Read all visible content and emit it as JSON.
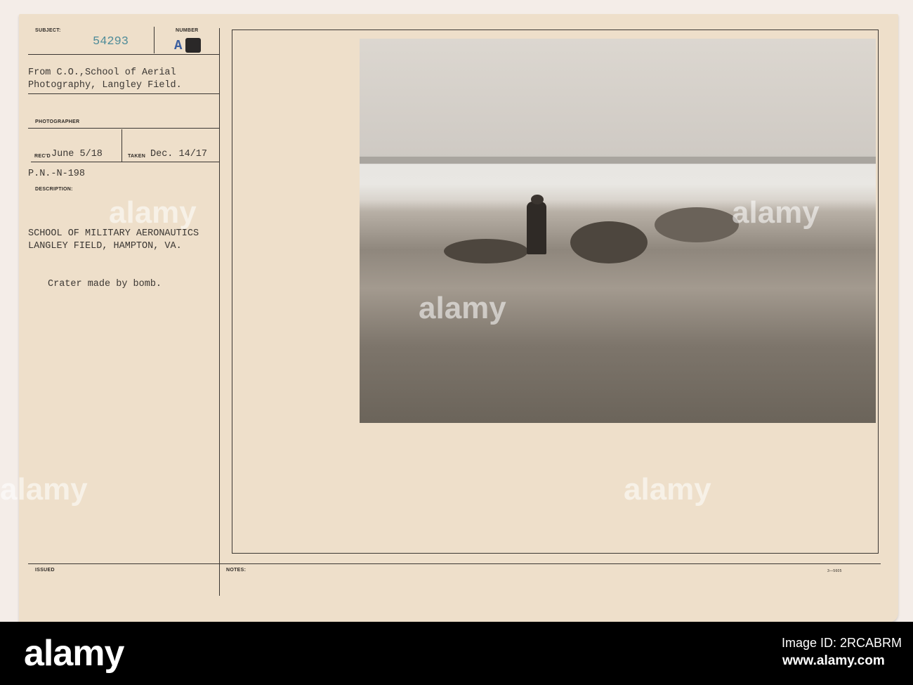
{
  "card": {
    "subject_label": "SUBJECT:",
    "subject_number": "54293",
    "number_label": "NUMBER",
    "number_value": "A",
    "from_line1": "From C.O.,School of Aerial",
    "from_line2": "Photography, Langley Field.",
    "photographer_label": "PHOTOGRAPHER",
    "recd_label": "REC'D",
    "recd_value": "June 5/18",
    "taken_label": "TAKEN",
    "taken_value": "Dec. 14/17",
    "pn": "P.N.-N-198",
    "description_label": "DESCRIPTION:",
    "desc_line1": "SCHOOL OF MILITARY AERONAUTICS",
    "desc_line2": "LANGLEY FIELD, HAMPTON, VA.",
    "desc_line3": "Crater made by bomb.",
    "issued_label": "ISSUED",
    "notes_label": "NOTES:",
    "form_number": "3—5605"
  },
  "watermark": "alamy",
  "footer": {
    "logo": "alamy",
    "image_id": "Image ID: 2RCABRM",
    "url": "www.alamy.com"
  }
}
